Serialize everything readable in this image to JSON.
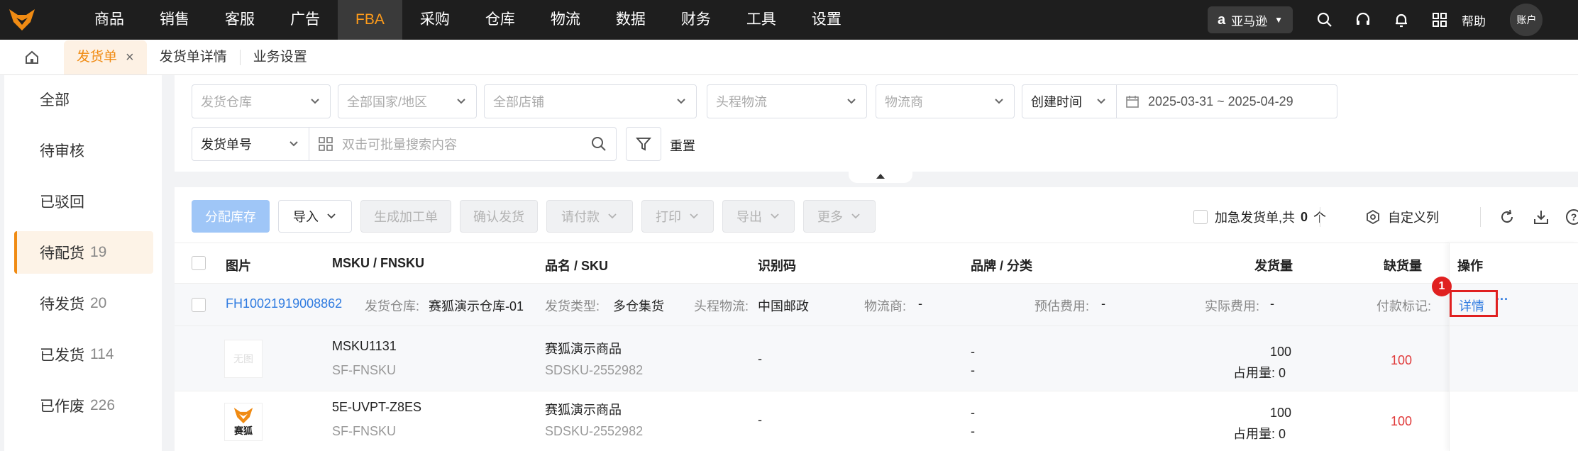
{
  "colors": {
    "accent": "#f08b13",
    "primary": "#2f7be0",
    "danger": "#e03a3a",
    "nav_bg": "#1e1e1e"
  },
  "nav": {
    "items": [
      "商品",
      "销售",
      "客服",
      "广告",
      "FBA",
      "采购",
      "仓库",
      "物流",
      "数据",
      "财务",
      "工具",
      "设置"
    ],
    "active": "FBA",
    "marketplace": "亚马逊",
    "help": "帮助",
    "account": "账户"
  },
  "tabs": {
    "items": [
      {
        "label": "发货单",
        "active": true
      },
      {
        "label": "发货单详情",
        "active": false
      },
      {
        "label": "业务设置",
        "active": false
      }
    ],
    "close_symbol": "×"
  },
  "sidebar": {
    "items": [
      {
        "label": "全部",
        "count": ""
      },
      {
        "label": "待审核",
        "count": ""
      },
      {
        "label": "已驳回",
        "count": ""
      },
      {
        "label": "待配货",
        "count": "19"
      },
      {
        "label": "待发货",
        "count": "20"
      },
      {
        "label": "已发货",
        "count": "114"
      },
      {
        "label": "已作废",
        "count": "226"
      }
    ],
    "active": "待配货"
  },
  "filters": {
    "warehouse": "发货仓库",
    "country": "全部国家/地区",
    "shop": "全部店铺",
    "first_leg": "头程物流",
    "carrier": "物流商",
    "time_type": "创建时间",
    "date_range": "2025-03-31 ~ 2025-04-29",
    "search_type": "发货单号",
    "search_placeholder": "双击可批量搜索内容",
    "reset": "重置"
  },
  "toolbar": {
    "allocate": "分配库存",
    "import": "导入",
    "generate_work_order": "生成加工单",
    "confirm_ship": "确认发货",
    "request_payment": "请付款",
    "print": "打印",
    "export": "导出",
    "more": "更多",
    "urgent_label": "加急发货单,共",
    "urgent_count": "0",
    "urgent_unit": "个",
    "custom_columns": "自定义列"
  },
  "table": {
    "headers": {
      "image": "图片",
      "msku": "MSKU / FNSKU",
      "name": "品名 / SKU",
      "code": "识别码",
      "brand": "品牌 / 分类",
      "qty": "发货量",
      "short": "缺货量",
      "ops": "操作"
    },
    "order": {
      "id": "FH10021919008862",
      "warehouse_label": "发货仓库:",
      "warehouse": "赛狐演示仓库-01",
      "ship_type_label": "发货类型:",
      "ship_type": "多仓集货",
      "first_leg_label": "头程物流:",
      "first_leg": "中国邮政",
      "carrier_label": "物流商:",
      "carrier": "-",
      "est_fee_label": "预估费用:",
      "est_fee": "-",
      "actual_fee_label": "实际费用:",
      "actual_fee": "-",
      "pay_mark_label": "付款标记:",
      "detail": "详情",
      "more": "···"
    },
    "rows": [
      {
        "image_text": "无图",
        "msku": "MSKU1131",
        "fnsku": "SF-FNSKU",
        "name": "赛狐演示商品",
        "sku": "SDSKU-2552982",
        "code": "-",
        "brand": "-",
        "category": "-",
        "qty": "100",
        "occupied_label": "占用量:",
        "occupied": "0",
        "short": "100"
      },
      {
        "image_text": "赛狐",
        "msku": "5E-UVPT-Z8ES",
        "fnsku": "SF-FNSKU",
        "name": "赛狐演示商品",
        "sku": "SDSKU-2552982",
        "code": "-",
        "brand": "-",
        "category": "-",
        "qty": "100",
        "occupied_label": "占用量:",
        "occupied": "0",
        "short": "100"
      }
    ]
  },
  "annotation": {
    "marker": "1"
  }
}
